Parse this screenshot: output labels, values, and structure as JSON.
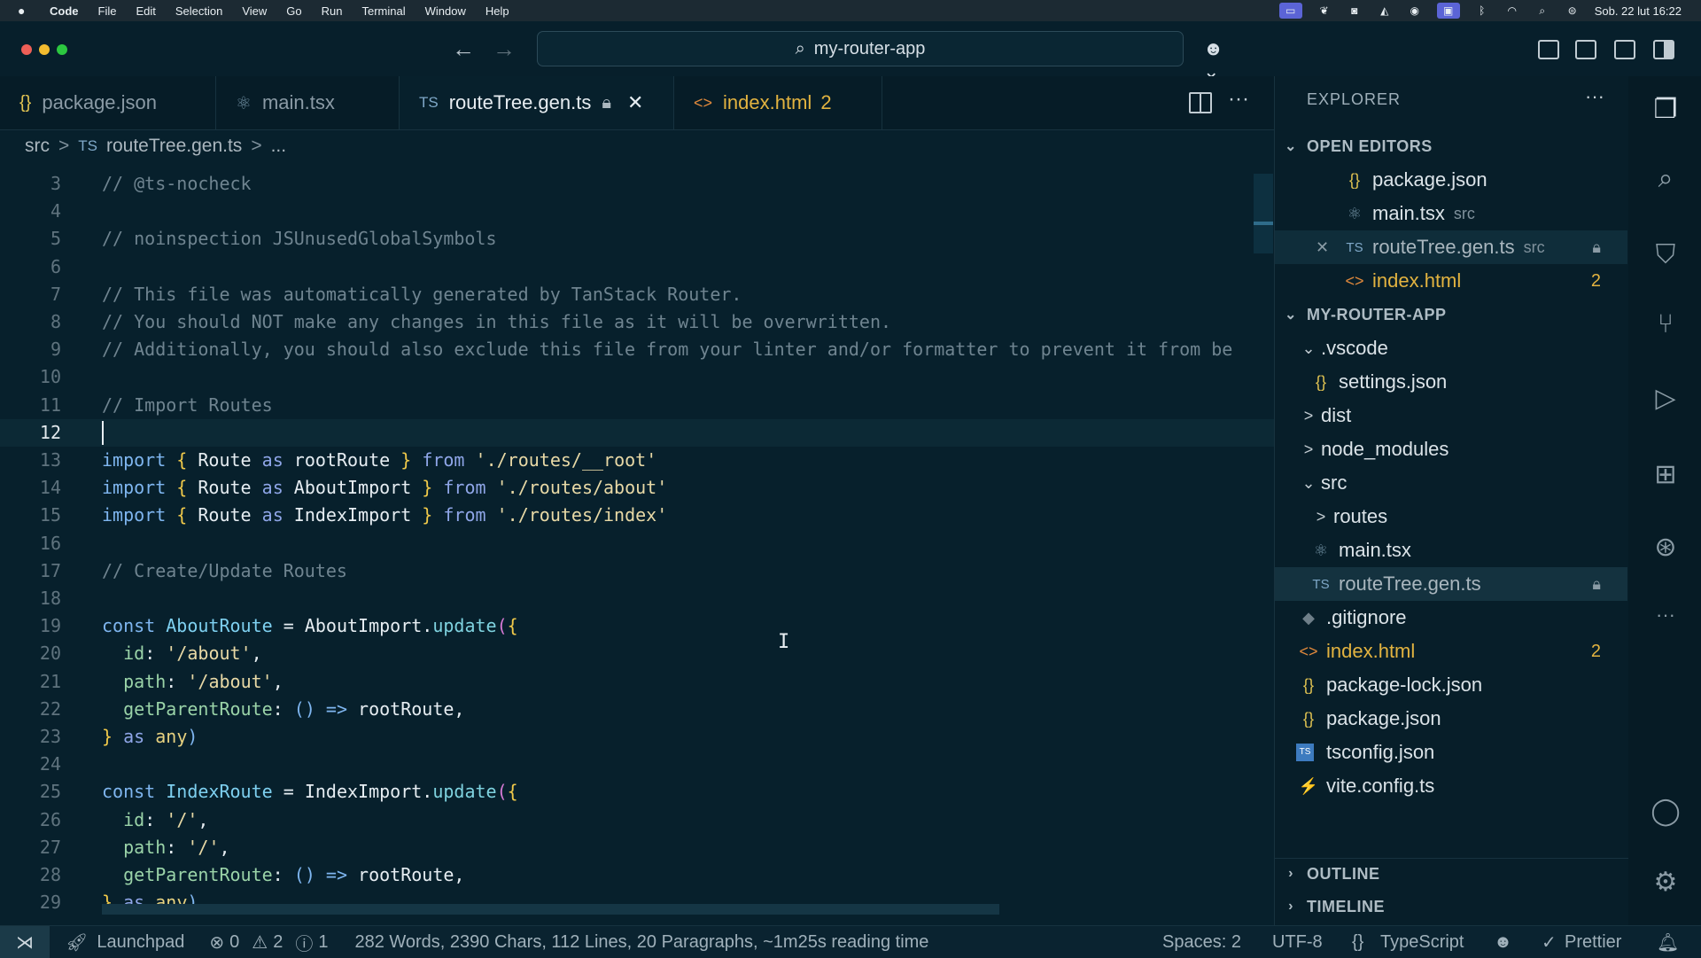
{
  "menubar": {
    "apple": "",
    "app": "Code",
    "items": [
      "File",
      "Edit",
      "Selection",
      "View",
      "Go",
      "Run",
      "Terminal",
      "Window",
      "Help"
    ],
    "datetime": "Sob. 22 lut 16:22"
  },
  "titlebar": {
    "search_text": "my-router-app"
  },
  "tabs": [
    {
      "icon": "{}",
      "label": "package.json"
    },
    {
      "icon": "⚛",
      "label": "main.tsx"
    },
    {
      "icon": "TS",
      "label": "routeTree.gen.ts"
    },
    {
      "icon": "<>",
      "label": "index.html",
      "badge": "2"
    }
  ],
  "breadcrumb": {
    "folder": "src",
    "sep1": ">",
    "file_icon": "TS",
    "file": "routeTree.gen.ts",
    "sep2": ">",
    "rest": "..."
  },
  "editor": {
    "current_line": 12,
    "lines": [
      {
        "n": "3",
        "text": "// @ts-nocheck"
      },
      {
        "n": "4",
        "text": ""
      },
      {
        "n": "5",
        "text": "// noinspection JSUnusedGlobalSymbols"
      },
      {
        "n": "6",
        "text": ""
      },
      {
        "n": "7",
        "text": "// This file was automatically generated by TanStack Router."
      },
      {
        "n": "8",
        "text": "// You should NOT make any changes in this file as it will be overwritten."
      },
      {
        "n": "9",
        "text": "// Additionally, you should also exclude this file from your linter and/or formatter to prevent it from be"
      },
      {
        "n": "10",
        "text": ""
      },
      {
        "n": "11",
        "text": "// Import Routes"
      },
      {
        "n": "12",
        "text": ""
      },
      {
        "n": "13",
        "text": "import { Route as rootRoute } from './routes/__root'"
      },
      {
        "n": "14",
        "text": "import { Route as AboutImport } from './routes/about'"
      },
      {
        "n": "15",
        "text": "import { Route as IndexImport } from './routes/index'"
      },
      {
        "n": "16",
        "text": ""
      },
      {
        "n": "17",
        "text": "// Create/Update Routes"
      },
      {
        "n": "18",
        "text": ""
      },
      {
        "n": "19",
        "text": "const AboutRoute = AboutImport.update({"
      },
      {
        "n": "20",
        "text": "  id: '/about',"
      },
      {
        "n": "21",
        "text": "  path: '/about',"
      },
      {
        "n": "22",
        "text": "  getParentRoute: () => rootRoute,"
      },
      {
        "n": "23",
        "text": "} as any)"
      },
      {
        "n": "24",
        "text": ""
      },
      {
        "n": "25",
        "text": "const IndexRoute = IndexImport.update({"
      },
      {
        "n": "26",
        "text": "  id: '/',"
      },
      {
        "n": "27",
        "text": "  path: '/',"
      },
      {
        "n": "28",
        "text": "  getParentRoute: () => rootRoute,"
      },
      {
        "n": "29",
        "text": "} as any)"
      }
    ]
  },
  "explorer": {
    "title": "EXPLORER",
    "more": "···",
    "open_editors_label": "OPEN EDITORS",
    "open_editors": [
      {
        "icon": "{}",
        "label": "package.json"
      },
      {
        "icon": "⚛",
        "label": "main.tsx",
        "sub": "src"
      },
      {
        "icon": "TS",
        "label": "routeTree.gen.ts",
        "sub": "src"
      },
      {
        "icon": "<>",
        "label": "index.html",
        "badge": "2"
      }
    ],
    "project_label": "MY-ROUTER-APP",
    "tree": [
      {
        "chev": "⌄",
        "icon": "",
        "label": ".vscode"
      },
      {
        "chev": "",
        "icon": "{}",
        "label": "settings.json"
      },
      {
        "chev": ">",
        "icon": "",
        "label": "dist"
      },
      {
        "chev": ">",
        "icon": "",
        "label": "node_modules"
      },
      {
        "chev": "⌄",
        "icon": "",
        "label": "src"
      },
      {
        "chev": ">",
        "icon": "",
        "label": "routes"
      },
      {
        "chev": "",
        "icon": "⚛",
        "label": "main.tsx"
      },
      {
        "chev": "",
        "icon": "TS",
        "label": "routeTree.gen.ts"
      },
      {
        "chev": "",
        "icon": "◆",
        "label": ".gitignore"
      },
      {
        "chev": "",
        "icon": "<>",
        "label": "index.html",
        "badge": "2"
      },
      {
        "chev": "",
        "icon": "{}",
        "label": "package-lock.json"
      },
      {
        "chev": "",
        "icon": "TS",
        "label": "tsconfig.json"
      },
      {
        "chev": "",
        "icon": "⚡",
        "label": "vite.config.ts"
      }
    ],
    "outline_label": "OUTLINE",
    "timeline_label": "TIMELINE"
  },
  "statusbar": {
    "remote": "⋊",
    "launchpad": "Launchpad",
    "errors": "0",
    "warnings": "2",
    "infos": "1",
    "stats": "282 Words, 2390 Chars, 112 Lines, 20 Paragraphs, ~1m25s reading time",
    "spaces": "Spaces: 2",
    "encoding": "UTF-8",
    "language": "TypeScript",
    "prettier": "Prettier"
  }
}
